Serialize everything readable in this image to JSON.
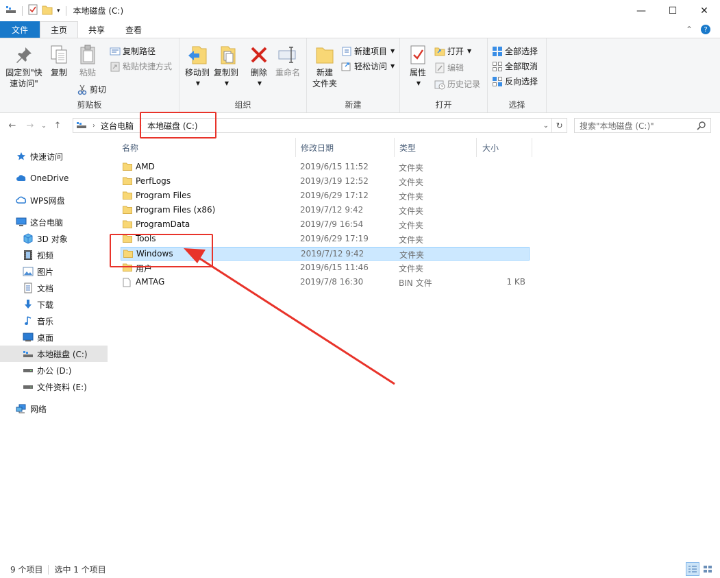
{
  "window": {
    "title": "本地磁盘 (C:)",
    "controls": {
      "minimize": "—",
      "maximize": "☐",
      "close": "✕"
    }
  },
  "tabs": [
    {
      "label": "文件"
    },
    {
      "label": "主页"
    },
    {
      "label": "共享"
    },
    {
      "label": "查看"
    }
  ],
  "ribbon": {
    "clipboard": {
      "group_label": "剪贴板",
      "pin": "固定到\"快",
      "pin2": "速访问\"",
      "copy": "复制",
      "paste": "粘贴",
      "copy_path": "复制路径",
      "paste_shortcut": "粘贴快捷方式",
      "cut": "剪切"
    },
    "organize": {
      "group_label": "组织",
      "move_to": "移动到",
      "copy_to": "复制到",
      "delete": "删除",
      "rename": "重命名"
    },
    "new": {
      "group_label": "新建",
      "new_folder_1": "新建",
      "new_folder_2": "文件夹",
      "new_item": "新建项目",
      "easy_access": "轻松访问"
    },
    "open": {
      "group_label": "打开",
      "properties": "属性",
      "open": "打开",
      "edit": "编辑",
      "history": "历史记录"
    },
    "select": {
      "group_label": "选择",
      "select_all": "全部选择",
      "select_none": "全部取消",
      "invert": "反向选择"
    }
  },
  "address": {
    "crumbs": [
      "这台电脑",
      "本地磁盘 (C:)"
    ],
    "search_placeholder": "搜索\"本地磁盘 (C:)\""
  },
  "sidebar": {
    "items": [
      {
        "label": "快速访问",
        "icon": "star-icon"
      },
      {
        "label": "OneDrive",
        "icon": "cloud-icon"
      },
      {
        "label": "WPS网盘",
        "icon": "cloud-wps-icon"
      },
      {
        "label": "这台电脑",
        "icon": "computer-icon"
      },
      {
        "label": "3D 对象",
        "icon": "cube-icon"
      },
      {
        "label": "视频",
        "icon": "video-icon"
      },
      {
        "label": "图片",
        "icon": "picture-icon"
      },
      {
        "label": "文档",
        "icon": "document-icon"
      },
      {
        "label": "下载",
        "icon": "download-icon"
      },
      {
        "label": "音乐",
        "icon": "music-icon"
      },
      {
        "label": "桌面",
        "icon": "desktop-icon"
      },
      {
        "label": "本地磁盘 (C:)",
        "icon": "drive-icon"
      },
      {
        "label": "办公 (D:)",
        "icon": "drive-icon"
      },
      {
        "label": "文件资料 (E:)",
        "icon": "drive-icon"
      },
      {
        "label": "网络",
        "icon": "network-icon"
      }
    ]
  },
  "columns": {
    "name": "名称",
    "date": "修改日期",
    "type": "类型",
    "size": "大小"
  },
  "files": [
    {
      "name": "AMD",
      "date": "2019/6/15 11:52",
      "type": "文件夹",
      "size": ""
    },
    {
      "name": "PerfLogs",
      "date": "2019/3/19 12:52",
      "type": "文件夹",
      "size": ""
    },
    {
      "name": "Program Files",
      "date": "2019/6/29 17:12",
      "type": "文件夹",
      "size": ""
    },
    {
      "name": "Program Files (x86)",
      "date": "2019/7/12 9:42",
      "type": "文件夹",
      "size": ""
    },
    {
      "name": "ProgramData",
      "date": "2019/7/9 16:54",
      "type": "文件夹",
      "size": ""
    },
    {
      "name": "Tools",
      "date": "2019/6/29 17:19",
      "type": "文件夹",
      "size": ""
    },
    {
      "name": "Windows",
      "date": "2019/7/12 9:42",
      "type": "文件夹",
      "size": ""
    },
    {
      "name": "用户",
      "date": "2019/6/15 11:46",
      "type": "文件夹",
      "size": ""
    },
    {
      "name": "AMTAG",
      "date": "2019/7/8 16:30",
      "type": "BIN 文件",
      "size": "1 KB"
    }
  ],
  "status": {
    "count": "9 个项目",
    "selected": "选中 1 个项目"
  },
  "colors": {
    "accent": "#1979ca",
    "selection": "#cce8ff",
    "annotation": "#e8332a",
    "folder": "#f8d775"
  }
}
